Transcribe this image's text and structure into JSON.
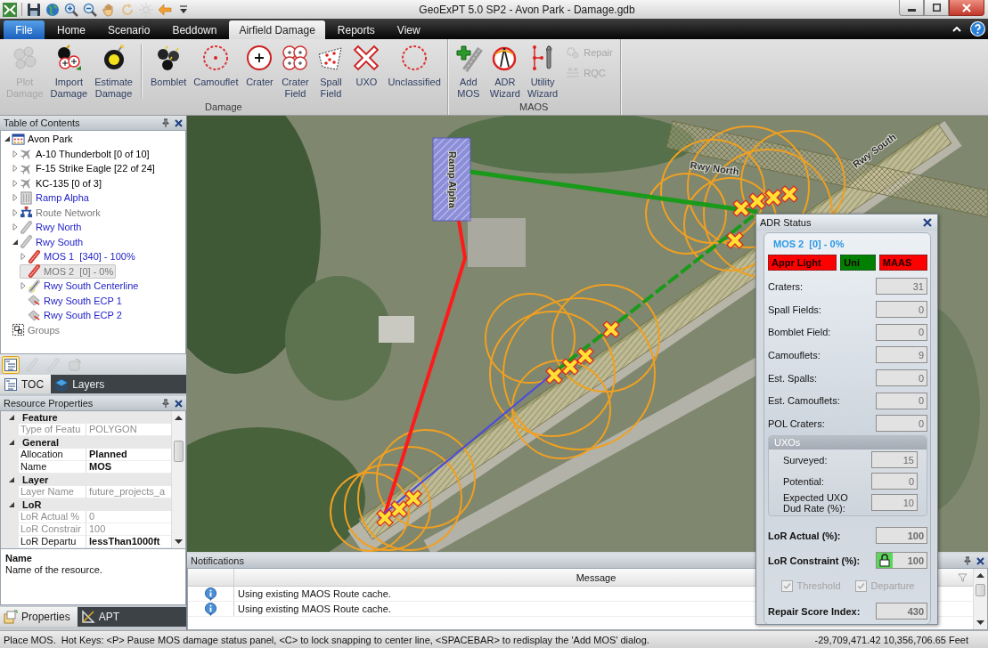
{
  "window": {
    "title": "GeoExPT 5.0 SP2 - Avon Park - Damage.gdb"
  },
  "quick_access": [
    {
      "disabled": false
    },
    {
      "disabled": false
    },
    {
      "disabled": false
    },
    {
      "disabled": false
    },
    {
      "disabled": false
    },
    {
      "disabled": true
    },
    {
      "disabled": true
    },
    {
      "disabled": false
    },
    {
      "disabled": false
    }
  ],
  "tabs": [
    {
      "label": "File",
      "kind": "application",
      "selected": false
    },
    {
      "label": "Home",
      "kind": "tab",
      "selected": false
    },
    {
      "label": "Scenario",
      "kind": "tab",
      "selected": false
    },
    {
      "label": "Beddown",
      "kind": "tab",
      "selected": false
    },
    {
      "label": "Airfield Damage",
      "kind": "tab",
      "selected": true
    },
    {
      "label": "Reports",
      "kind": "tab",
      "selected": false
    },
    {
      "label": "View",
      "kind": "tab",
      "selected": false
    }
  ],
  "ribbon": {
    "groups": [
      {
        "label": "Damage",
        "sections": [
          [
            {
              "label": "Plot Damage",
              "kind": "large",
              "disabled": true
            },
            {
              "label": "Import Damage",
              "kind": "large",
              "disabled": false
            },
            {
              "label": "Estimate Damage",
              "kind": "large",
              "disabled": false
            }
          ],
          [
            {
              "label": "Bomblet",
              "kind": "large",
              "disabled": false
            },
            {
              "label": "Camouflet",
              "kind": "large",
              "disabled": false
            },
            {
              "label": "Crater",
              "kind": "large",
              "disabled": false
            },
            {
              "label": "Crater Field",
              "kind": "large",
              "disabled": false
            },
            {
              "label": "Spall Field",
              "kind": "large",
              "disabled": false
            },
            {
              "label": "UXO",
              "kind": "large",
              "disabled": false
            },
            {
              "label": "Unclassified",
              "kind": "large",
              "disabled": false
            }
          ]
        ]
      },
      {
        "label": "MAOS",
        "sections": [
          [
            {
              "label": "Add MOS",
              "kind": "large",
              "disabled": false
            },
            {
              "label": "ADR Wizard",
              "kind": "large",
              "disabled": false
            },
            {
              "label": "Utility Wizard",
              "kind": "large",
              "disabled": false
            },
            {
              "label": "Repair",
              "kind": "small",
              "disabled": true
            },
            {
              "label": "RQC",
              "kind": "small",
              "disabled": true
            }
          ]
        ]
      }
    ]
  },
  "toc": {
    "title": "Table of Contents",
    "tree": [
      {
        "label": "Avon Park",
        "kind": "airbase",
        "expanded": true,
        "selected": false,
        "color": "#000000",
        "children": [
          {
            "label": "A-10 Thunderbolt [0 of 10]",
            "kind": "aircraft",
            "expanded": false,
            "selected": false,
            "color": "#000000"
          },
          {
            "label": "F-15 Strike Eagle [22 of 24]",
            "kind": "aircraft",
            "expanded": false,
            "selected": false,
            "color": "#000000"
          },
          {
            "label": "KC-135 [0 of 3]",
            "kind": "aircraft",
            "expanded": false,
            "selected": false,
            "color": "#000000"
          },
          {
            "label": "Ramp Alpha",
            "kind": "ramp",
            "expanded": false,
            "selected": false,
            "color": "#2222c8"
          },
          {
            "label": "Route Network",
            "kind": "network",
            "expanded": false,
            "selected": false,
            "color": "#777777"
          },
          {
            "label": "Rwy North",
            "kind": "runway",
            "expanded": false,
            "selected": false,
            "color": "#2222c8"
          },
          {
            "label": "Rwy South",
            "kind": "runway",
            "expanded": true,
            "selected": false,
            "color": "#2222c8",
            "children": [
              {
                "label": "MOS 1  [340] - 100%",
                "kind": "mos",
                "expanded": false,
                "selected": false,
                "color": "#2222c8"
              },
              {
                "label": "MOS 2  [0] - 0%",
                "kind": "mos",
                "selected": true,
                "color": "#777777"
              },
              {
                "label": "Rwy South Centerline",
                "kind": "centerline",
                "expanded": false,
                "selected": false,
                "color": "#2222c8"
              },
              {
                "label": "Rwy South ECP 1",
                "kind": "ecp",
                "selected": false,
                "color": "#2222c8"
              },
              {
                "label": "Rwy South ECP 2",
                "kind": "ecp",
                "selected": false,
                "color": "#2222c8"
              }
            ]
          }
        ]
      },
      {
        "label": "Groups",
        "kind": "groups",
        "selected": false,
        "color": "#777777"
      }
    ],
    "toolbar": [
      {
        "selected": true,
        "disabled": false
      },
      {
        "selected": false,
        "disabled": true
      },
      {
        "selected": false,
        "disabled": true
      },
      {
        "selected": false,
        "disabled": true
      }
    ],
    "tabs": [
      {
        "label": "TOC",
        "selected": true
      },
      {
        "label": "Layers",
        "selected": false
      }
    ]
  },
  "properties": {
    "title": "Resource Properties",
    "categories": [
      {
        "label": "Feature",
        "expanded": true,
        "rows": [
          {
            "name": "Type of Featu",
            "value": "POLYGON",
            "readonly": true,
            "modified": false
          }
        ]
      },
      {
        "label": "General",
        "expanded": true,
        "rows": [
          {
            "name": "Allocation",
            "value": "Planned",
            "readonly": false,
            "modified": true
          },
          {
            "name": "Name",
            "value": "MOS",
            "readonly": false,
            "modified": true
          }
        ]
      },
      {
        "label": "Layer",
        "expanded": true,
        "rows": [
          {
            "name": "Layer Name",
            "value": "future_projects_a",
            "readonly": true,
            "modified": false
          }
        ]
      },
      {
        "label": "LoR",
        "expanded": true,
        "rows": [
          {
            "name": "LoR Actual %",
            "value": "0",
            "readonly": true,
            "modified": false
          },
          {
            "name": "LoR Constrair",
            "value": "100",
            "readonly": true,
            "modified": false
          },
          {
            "name": "LoR Departu",
            "value": "lessThan1000ft",
            "readonly": false,
            "modified": true
          }
        ]
      }
    ],
    "description": {
      "title": "Name",
      "text": "Name of the resource."
    },
    "tabs": [
      {
        "label": "Properties",
        "selected": true
      },
      {
        "label": "APT",
        "selected": false
      }
    ]
  },
  "map": {
    "labels": [
      "Ramp Alpha",
      "Rwy North",
      "Rwy South"
    ]
  },
  "adr_status": {
    "title": "ADR Status",
    "mos": "MOS 2  [0] - 0%",
    "badges": [
      {
        "label": "Appr Light",
        "color": "#ff0000"
      },
      {
        "label": "Uni",
        "color": "#008000"
      },
      {
        "label": "MAAS",
        "color": "#ff0000"
      }
    ],
    "counts": [
      {
        "label": "Craters:",
        "value": "31"
      },
      {
        "label": "Spall Fields:",
        "value": "0"
      },
      {
        "label": "Bomblet Field:",
        "value": "0"
      },
      {
        "label": "Camouflets:",
        "value": "9"
      },
      {
        "label": "Est. Spalls:",
        "value": "0"
      },
      {
        "label": "Est. Camouflets:",
        "value": "0"
      },
      {
        "label": "POL Craters:",
        "value": "0"
      }
    ],
    "uxo": {
      "title": "UXOs",
      "fields": [
        {
          "label": "Surveyed:",
          "value": "15"
        },
        {
          "label": "Potential:",
          "value": "0"
        },
        {
          "label": "Expected UXO Dud Rate (%):",
          "value": "10"
        }
      ]
    },
    "lor": [
      {
        "label": "LoR Actual (%):",
        "value": "100",
        "locked": false
      },
      {
        "label": "LoR Constraint (%):",
        "value": "100",
        "locked": true
      }
    ],
    "checks": [
      {
        "label": "Threshold",
        "checked": true,
        "disabled": true
      },
      {
        "label": "Departure",
        "checked": true,
        "disabled": true
      }
    ],
    "score": {
      "label": "Repair Score Index:",
      "value": "430"
    }
  },
  "notifications": {
    "title": "Notifications",
    "columns": [
      "Message"
    ],
    "rows": [
      {
        "kind": "info",
        "message": "Using existing MAOS Route cache."
      },
      {
        "kind": "info",
        "message": "Using existing MAOS Route cache."
      }
    ]
  },
  "status_bar": {
    "message": "Place MOS.  Hot Keys: <P> Pause MOS damage status panel, <C> to lock snapping to center line, <SPACEBAR> to redisplay the 'Add MOS' dialog.",
    "coordinates": "-29,709,471.42 10,356,706.65 Feet"
  }
}
